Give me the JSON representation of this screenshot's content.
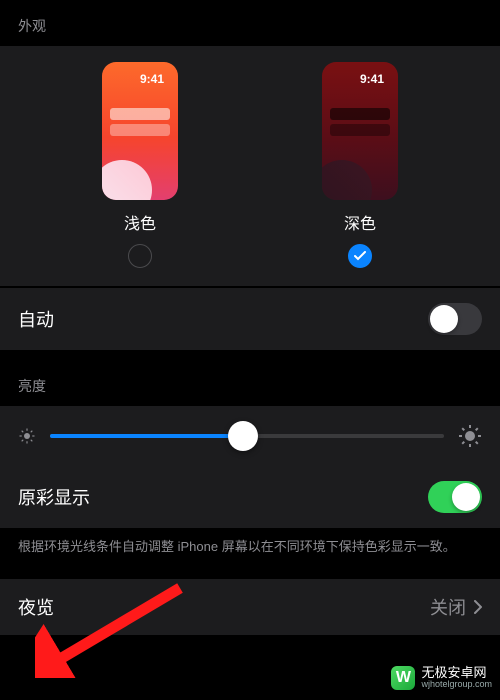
{
  "appearance": {
    "section_label": "外观",
    "light_label": "浅色",
    "dark_label": "深色",
    "preview_time": "9:41",
    "selected": "dark",
    "auto_label": "自动",
    "auto_enabled": false
  },
  "brightness": {
    "section_label": "亮度",
    "value_percent": 49,
    "true_tone_label": "原彩显示",
    "true_tone_enabled": true,
    "true_tone_note": "根据环境光线条件自动调整 iPhone 屏幕以在不同环境下保持色彩显示一致。"
  },
  "night_shift": {
    "label": "夜览",
    "value": "关闭"
  },
  "watermark": {
    "title": "无极安卓网",
    "subtitle": "wjhotelgroup.com"
  }
}
